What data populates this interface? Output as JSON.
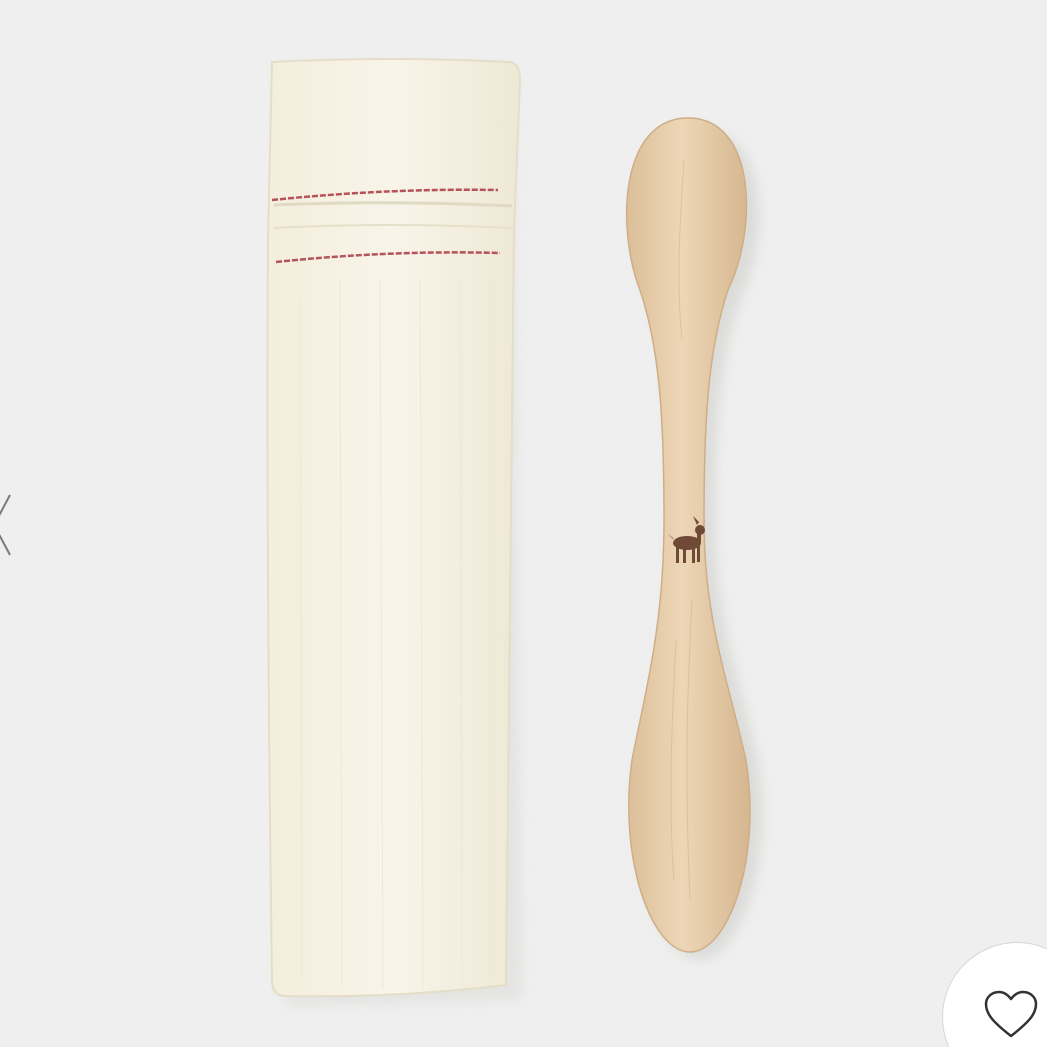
{
  "photo": {
    "background_color": "#efefef",
    "subject": "linen-pouch-and-wooden-spoon",
    "pouch_color": "#f6f1e2",
    "stitch_color": "#b5525a",
    "spoon_color": "#e8cfae",
    "deer_mark_color": "#6e4a37"
  },
  "controls": {
    "prev_icon": "chevron-left-icon",
    "favorite_icon": "heart-outline-icon",
    "favorite_active": false
  }
}
